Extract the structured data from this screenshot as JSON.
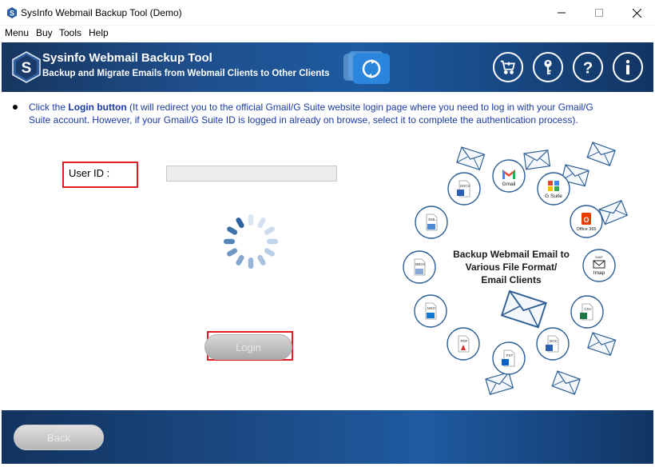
{
  "window": {
    "title": "SysInfo Webmail Backup Tool (Demo)"
  },
  "menu": {
    "items": [
      "Menu",
      "Buy",
      "Tools",
      "Help"
    ]
  },
  "header": {
    "title": "Sysinfo Webmail Backup Tool",
    "subtitle": "Backup and Migrate Emails from Webmail Clients to Other Clients",
    "logo_letter": "S"
  },
  "instruction": {
    "prefix": "Click the ",
    "highlight": "Login button",
    "suffix": " (It will redirect you to the official Gmail/G Suite website login page where you need to log in with your Gmail/G Suite account. However, if your Gmail/G Suite ID is logged in already on browse, select it to complete the authentication process)."
  },
  "form": {
    "user_id_label": "User ID  :",
    "user_id_value": ""
  },
  "buttons": {
    "login": "Login",
    "back": "Back"
  },
  "illustration": {
    "caption_line1": "Backup Webmail Email to",
    "caption_line2": "Various File Format/",
    "caption_line3": "Email Clients",
    "badges": {
      "gmail": "Gmail",
      "gsuite": "G Suite",
      "office365": "Office 365",
      "imap": "Imap",
      "docx": "DOCX",
      "eml": "EML",
      "mbox": "MBOX",
      "msg": "MSG",
      "pdf": "PDF",
      "pst": "PST",
      "doc": "DOC",
      "csv": "CSV",
      "imap_tag": "IMAP"
    }
  },
  "colors": {
    "accent_red": "#e11b22",
    "instruction_blue": "#1a3aa8",
    "banner_blue": "#1f4f8c"
  }
}
